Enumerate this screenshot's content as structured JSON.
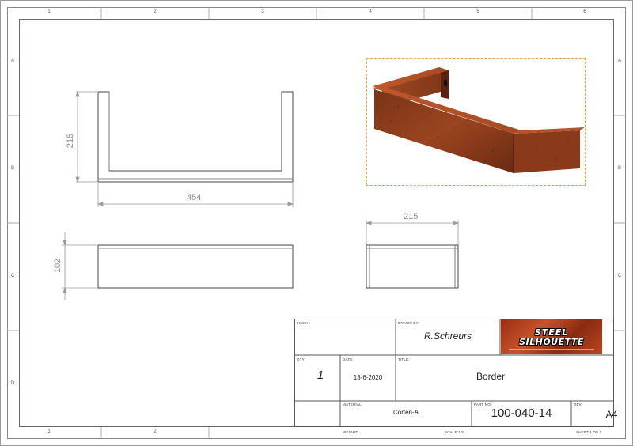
{
  "borders": {
    "top_numbers": [
      "1",
      "2",
      "3",
      "4",
      "5",
      "6"
    ],
    "bottom_numbers": [
      "1",
      "2"
    ],
    "side_letters": [
      "A",
      "B",
      "C",
      "D"
    ]
  },
  "dimensions": {
    "front_height": "215",
    "front_width": "454",
    "bottom_height": "102",
    "side_width": "215"
  },
  "title_block": {
    "finish_label": "FINISH:",
    "drawn_by_label": "DRAWN BY:",
    "drawn_by": "R.Schreurs",
    "qty_label": "QTY:",
    "qty": "1",
    "date_label": "DATE:",
    "date": "13-6-2020",
    "title_label": "TITLE:",
    "title": "Border",
    "material_label": "MATERIAL:",
    "material": "Corten-A",
    "part_no_label": "PART NO.:",
    "part_no": "100-040-14",
    "rev_label": "REV.",
    "sheet_size": "A4",
    "weight_label": "WEIGHT:",
    "scale": "SCALE:1:5",
    "sheet": "SHEET 1 OF 1"
  },
  "logo": {
    "line1": "STEEL",
    "line2": "SILHOUETTE"
  },
  "colors": {
    "line": "#444444",
    "dimension": "#9a9a9a",
    "corten_dark": "#5a2410",
    "corten_mid": "#8a3a1a",
    "corten_light": "#a44a22",
    "selection": "#f0a030"
  }
}
